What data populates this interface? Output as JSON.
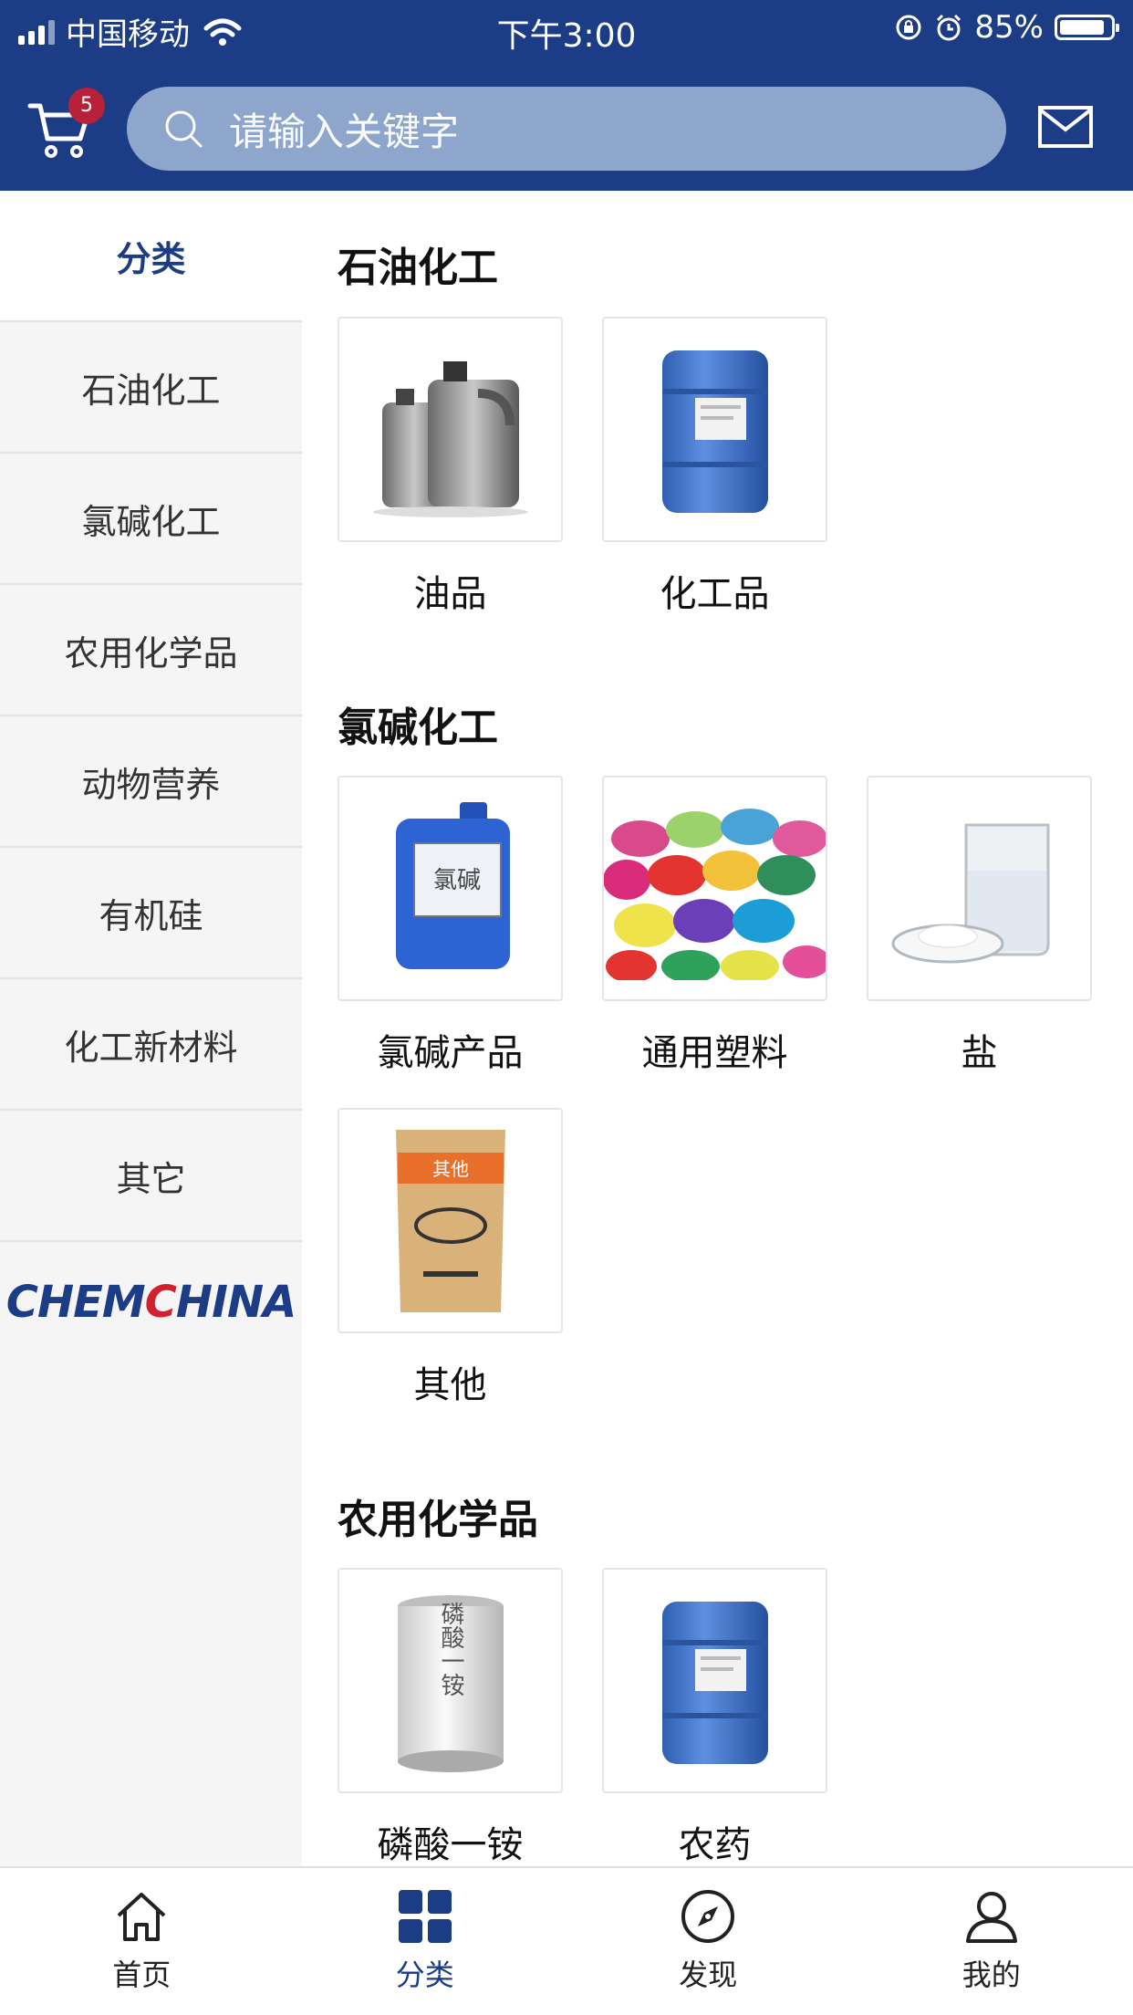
{
  "status_bar": {
    "carrier": "中国移动",
    "time": "下午3:00",
    "battery": "85%"
  },
  "header": {
    "cart_count": "5",
    "search_placeholder": "请输入关键字"
  },
  "sidebar": {
    "items": [
      {
        "label": "分类",
        "active": true
      },
      {
        "label": "石油化工"
      },
      {
        "label": "氯碱化工"
      },
      {
        "label": "农用化学品"
      },
      {
        "label": "动物营养"
      },
      {
        "label": "有机硅"
      },
      {
        "label": "化工新材料"
      },
      {
        "label": "其它"
      }
    ],
    "logo_text": "CHEMCHINA"
  },
  "sections": [
    {
      "title": "石油化工",
      "items": [
        {
          "label": "油品"
        },
        {
          "label": "化工品"
        }
      ]
    },
    {
      "title": "氯碱化工",
      "items": [
        {
          "label": "氯碱产品",
          "image_text": "氯碱"
        },
        {
          "label": "通用塑料"
        },
        {
          "label": "盐"
        },
        {
          "label": "其他",
          "image_text": "其他"
        }
      ]
    },
    {
      "title": "农用化学品",
      "items": [
        {
          "label": "磷酸一铵",
          "image_text": "磷酸一铵"
        },
        {
          "label": "农药"
        }
      ]
    }
  ],
  "tabbar": [
    {
      "label": "首页",
      "icon": "home-icon"
    },
    {
      "label": "分类",
      "icon": "grid-icon",
      "active": true
    },
    {
      "label": "发现",
      "icon": "compass-icon"
    },
    {
      "label": "我的",
      "icon": "user-icon"
    }
  ],
  "colors": {
    "brand": "#1c3d86",
    "badge": "#b8213a",
    "search_bg": "#8fa6cc"
  }
}
